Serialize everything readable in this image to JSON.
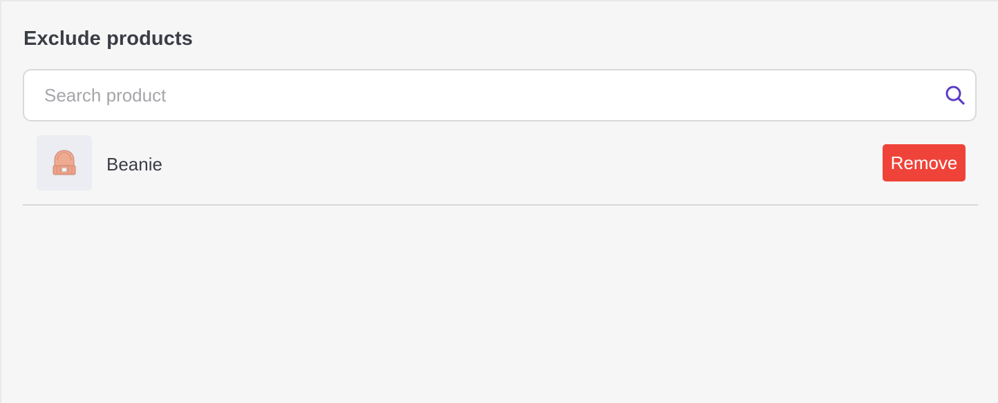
{
  "section": {
    "title": "Exclude products"
  },
  "search": {
    "placeholder": "Search product",
    "value": "",
    "icon": "search-icon",
    "icon_color": "#5b3cc4"
  },
  "products": [
    {
      "name": "Beanie",
      "thumbnail_icon": "beanie-image",
      "remove_label": "Remove"
    }
  ],
  "colors": {
    "remove_button": "#ef4339",
    "background": "#f6f6f6",
    "text": "#3a3d45"
  }
}
